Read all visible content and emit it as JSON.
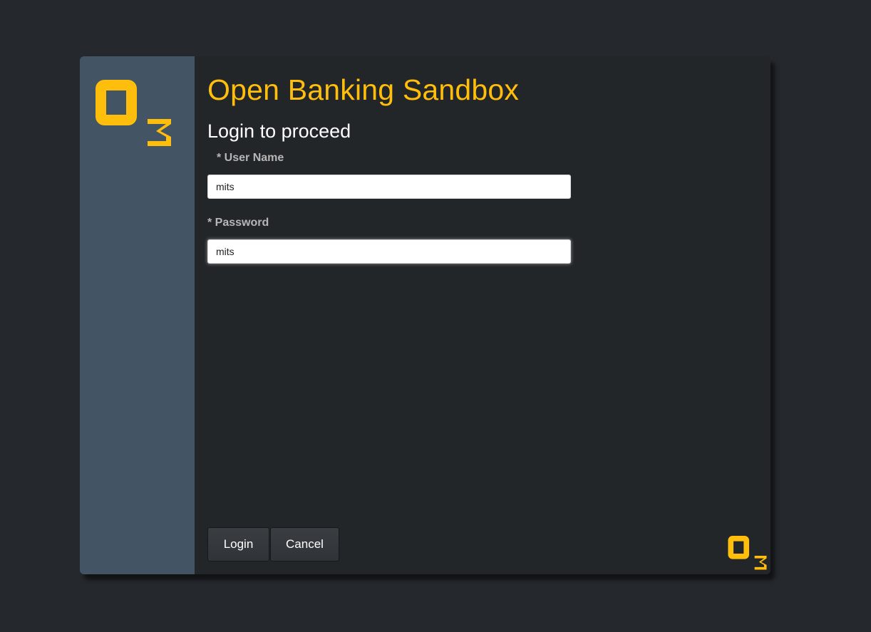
{
  "app": {
    "title": "Open Banking Sandbox",
    "subtitle": "Login to proceed",
    "accent_color": "#ffbe0b",
    "sidebar_color": "#435464",
    "logo_icon": "o3-logo"
  },
  "form": {
    "username_label": "* User Name",
    "username_value": "mits",
    "password_label": "* Password",
    "password_value": "mits"
  },
  "actions": {
    "login_label": "Login",
    "cancel_label": "Cancel"
  }
}
